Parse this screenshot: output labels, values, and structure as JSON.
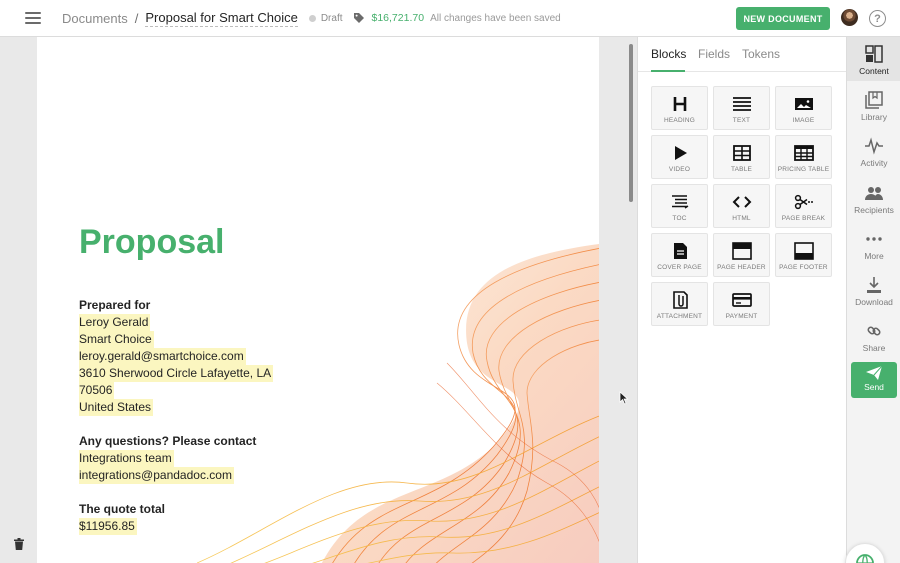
{
  "topbar": {
    "menu_icon": "hamburger-menu-icon",
    "breadcrumb_root": "Documents",
    "breadcrumb_sep": "/",
    "document_title": "Proposal for Smart Choice",
    "status": "Draft",
    "price": "$16,721.70",
    "save_status": "All changes have been saved",
    "new_document_label": "NEW DOCUMENT",
    "help_label": "?"
  },
  "document": {
    "title": "Proposal",
    "prepared_for_label": "Prepared for",
    "recipient_lines": [
      "Leroy Gerald",
      "Smart Choice",
      "leroy.gerald@smartchoice.com",
      "3610 Sherwood Circle Lafayette, LA",
      "70506",
      "United States"
    ],
    "contact_label": "Any questions? Please contact",
    "contact_lines": [
      "Integrations team",
      "integrations@pandadoc.com"
    ],
    "quote_label": "The quote total",
    "quote_total": "$11956.85"
  },
  "panel": {
    "tabs": [
      "Blocks",
      "Fields",
      "Tokens"
    ],
    "active_tab": "Blocks",
    "blocks": [
      {
        "label": "HEADING",
        "icon": "heading-icon"
      },
      {
        "label": "TEXT",
        "icon": "text-icon"
      },
      {
        "label": "IMAGE",
        "icon": "image-icon"
      },
      {
        "label": "VIDEO",
        "icon": "video-icon"
      },
      {
        "label": "TABLE",
        "icon": "table-icon"
      },
      {
        "label": "PRICING TABLE",
        "icon": "pricing-table-icon"
      },
      {
        "label": "TOC",
        "icon": "toc-icon"
      },
      {
        "label": "HTML",
        "icon": "html-icon"
      },
      {
        "label": "PAGE BREAK",
        "icon": "page-break-icon"
      },
      {
        "label": "COVER PAGE",
        "icon": "cover-page-icon"
      },
      {
        "label": "PAGE HEADER",
        "icon": "page-header-icon"
      },
      {
        "label": "PAGE FOOTER",
        "icon": "page-footer-icon"
      },
      {
        "label": "ATTACHMENT",
        "icon": "attachment-icon"
      },
      {
        "label": "PAYMENT",
        "icon": "payment-icon"
      }
    ]
  },
  "rail": {
    "items": [
      {
        "label": "Content",
        "icon": "content-icon",
        "active": true
      },
      {
        "label": "Library",
        "icon": "library-icon"
      },
      {
        "label": "Activity",
        "icon": "activity-icon"
      },
      {
        "label": "Recipients",
        "icon": "recipients-icon"
      },
      {
        "label": "More",
        "icon": "more-icon"
      },
      {
        "label": "Download",
        "icon": "download-icon"
      },
      {
        "label": "Share",
        "icon": "share-icon"
      }
    ],
    "send_label": "Send"
  },
  "colors": {
    "brand_green": "#47b06d",
    "highlight": "#fbf6c0"
  }
}
